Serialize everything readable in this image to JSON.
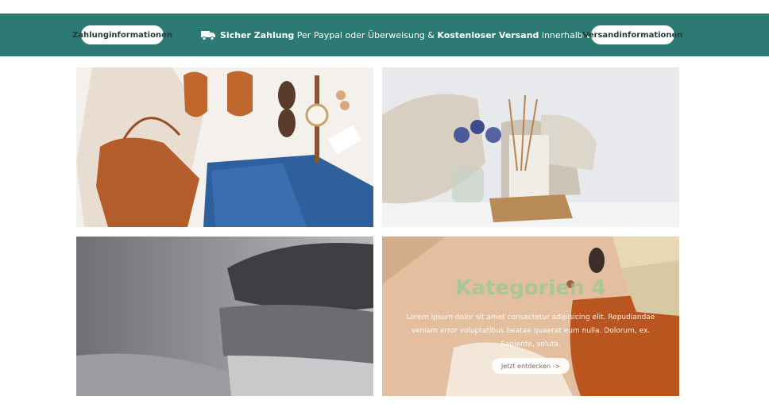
{
  "banner": {
    "left_button": "Zahlunginformationen",
    "right_button": "Versandinformationen",
    "bold1": "Sicher Zahlung",
    "text1": " Per Paypal oder Überweisung & ",
    "bold2": "Kostenloser Versand",
    "text2": " innerhalb von Deutschland",
    "color": "#2d7a74"
  },
  "tiles": [
    {
      "name": "category-1"
    },
    {
      "name": "category-2"
    },
    {
      "name": "category-3"
    },
    {
      "name": "category-4",
      "title": "Kategorien 4",
      "text": "Lorem ipsum dolor sit amet consectetur adipisicing elit. Repudiandae veniam error voluptatibus beatae quaerat eum nulla. Dolorum, ex. Sapiente, soluta.",
      "button": "Jetzt entdecken ->"
    }
  ]
}
